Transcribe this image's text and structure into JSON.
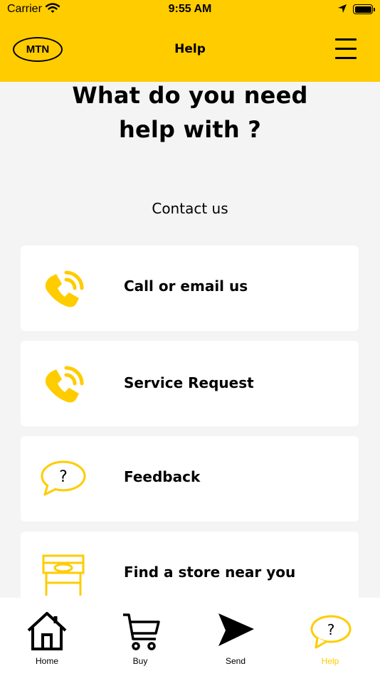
{
  "status_bar": {
    "carrier": "Carrier",
    "time": "9:55 AM"
  },
  "header": {
    "logo_text": "MTN",
    "title": "Help"
  },
  "page": {
    "heading_line1": "What do you need",
    "heading_line2": "help with ?",
    "section_title": "Contact us"
  },
  "cards": [
    {
      "label": "Call or email us",
      "icon": "phone-icon"
    },
    {
      "label": "Service Request",
      "icon": "phone-icon"
    },
    {
      "label": "Feedback",
      "icon": "question-bubble-icon"
    },
    {
      "label": "Find a store near you",
      "icon": "store-icon"
    }
  ],
  "tabs": [
    {
      "label": "Home",
      "icon": "home-icon"
    },
    {
      "label": "Buy",
      "icon": "cart-icon"
    },
    {
      "label": "Send",
      "icon": "send-icon"
    },
    {
      "label": "Help",
      "icon": "question-bubble-icon",
      "active": true
    }
  ],
  "colors": {
    "brand_yellow": "#ffcc00",
    "background": "#f4f4f4",
    "card": "#ffffff",
    "text": "#000000"
  }
}
